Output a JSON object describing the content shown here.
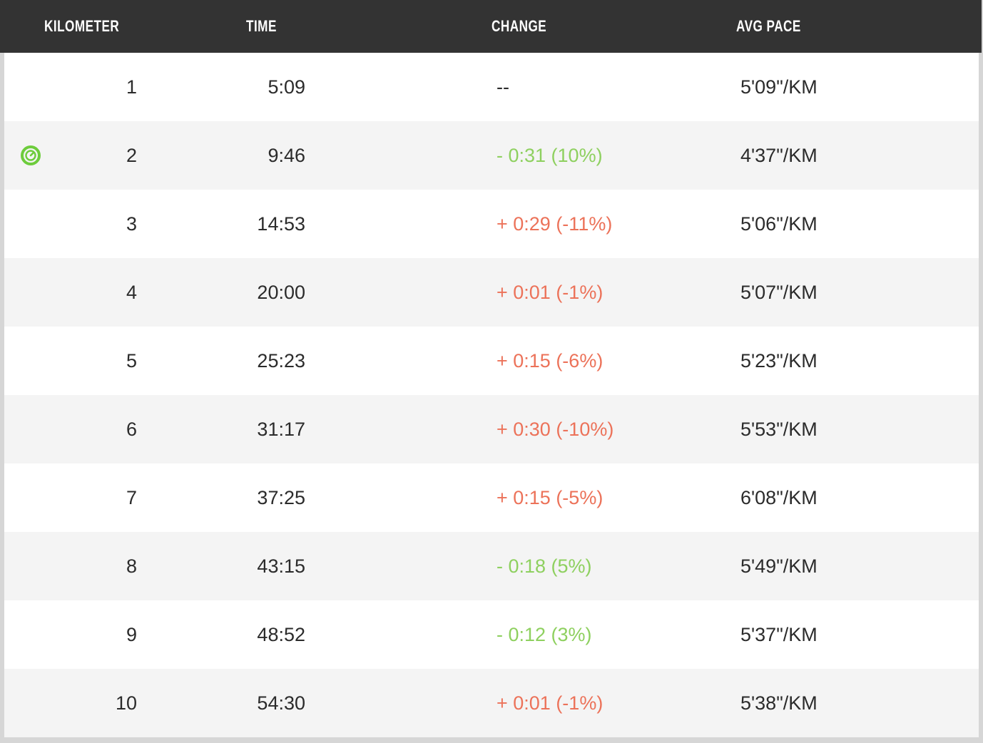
{
  "table": {
    "columns": [
      {
        "key": "kilometer",
        "label": "KILOMETER"
      },
      {
        "key": "time",
        "label": "TIME"
      },
      {
        "key": "change",
        "label": "CHANGE"
      },
      {
        "key": "pace",
        "label": "AVG PACE"
      }
    ],
    "header_bg": "#333333",
    "header_fg": "#ffffff",
    "row_bg": "#ffffff",
    "row_alt_bg": "#f4f4f4",
    "positive_change_color": "#ec7259",
    "negative_change_color": "#8ed05f",
    "marker_color": "#6dcc3c",
    "marker_icon": "speedometer-icon",
    "rows": [
      {
        "kilometer": "1",
        "time": "5:09",
        "change": "--",
        "change_sign": "none",
        "pace": "5'09\"/KM",
        "best": false
      },
      {
        "kilometer": "2",
        "time": "9:46",
        "change": "- 0:31 (10%)",
        "change_sign": "neg",
        "pace": "4'37\"/KM",
        "best": true
      },
      {
        "kilometer": "3",
        "time": "14:53",
        "change": "+ 0:29 (-11%)",
        "change_sign": "pos",
        "pace": "5'06\"/KM",
        "best": false
      },
      {
        "kilometer": "4",
        "time": "20:00",
        "change": "+ 0:01 (-1%)",
        "change_sign": "pos",
        "pace": "5'07\"/KM",
        "best": false
      },
      {
        "kilometer": "5",
        "time": "25:23",
        "change": "+ 0:15 (-6%)",
        "change_sign": "pos",
        "pace": "5'23\"/KM",
        "best": false
      },
      {
        "kilometer": "6",
        "time": "31:17",
        "change": "+ 0:30 (-10%)",
        "change_sign": "pos",
        "pace": "5'53\"/KM",
        "best": false
      },
      {
        "kilometer": "7",
        "time": "37:25",
        "change": "+ 0:15 (-5%)",
        "change_sign": "pos",
        "pace": "6'08\"/KM",
        "best": false
      },
      {
        "kilometer": "8",
        "time": "43:15",
        "change": "- 0:18 (5%)",
        "change_sign": "neg",
        "pace": "5'49\"/KM",
        "best": false
      },
      {
        "kilometer": "9",
        "time": "48:52",
        "change": "- 0:12 (3%)",
        "change_sign": "neg",
        "pace": "5'37\"/KM",
        "best": false
      },
      {
        "kilometer": "10",
        "time": "54:30",
        "change": "+ 0:01 (-1%)",
        "change_sign": "pos",
        "pace": "5'38\"/KM",
        "best": false
      }
    ]
  }
}
